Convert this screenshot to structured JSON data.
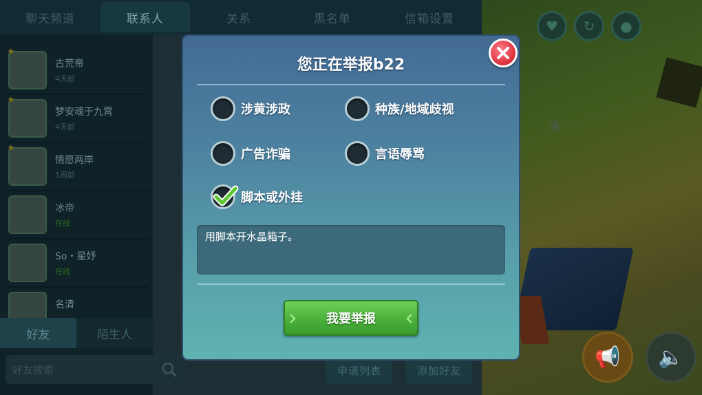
{
  "background": {
    "top_tabs": [
      "聊天频道",
      "联系人",
      "关系",
      "黑名单",
      "信箱设置"
    ],
    "active_top_tab": 1,
    "friends": [
      {
        "name": "古荒帝",
        "status": "4天前",
        "online": false
      },
      {
        "name": "梦安魂于九霄",
        "status": "4天前",
        "online": false
      },
      {
        "name": "情愿两岸",
        "status": "1周前",
        "online": false
      },
      {
        "name": "冰帝",
        "status": "在线",
        "online": true
      },
      {
        "name": "So・星妤",
        "status": "在线",
        "online": true
      },
      {
        "name": "名清",
        "status": "",
        "online": false
      }
    ],
    "bottom_tabs": [
      "好友",
      "陌生人"
    ],
    "search_placeholder": "好友搜索",
    "apply_list_button": "申请列表",
    "add_friend_button": "添加好友"
  },
  "dialog": {
    "title": "您正在举报b22",
    "options": [
      {
        "label": "涉黄涉政",
        "checked": false
      },
      {
        "label": "种族/地域歧视",
        "checked": false
      },
      {
        "label": "广告诈骗",
        "checked": false
      },
      {
        "label": "言语辱骂",
        "checked": false
      },
      {
        "label": "脚本或外挂",
        "checked": true
      }
    ],
    "reason_text": "用脚本开水晶箱子。",
    "submit_label": "我要举报"
  },
  "colors": {
    "dialog_top": "#436a94",
    "dialog_bottom": "#5fb3b0",
    "submit_green": "#4ab03a",
    "close_red": "#d9303c",
    "check_green": "#5cc830"
  }
}
